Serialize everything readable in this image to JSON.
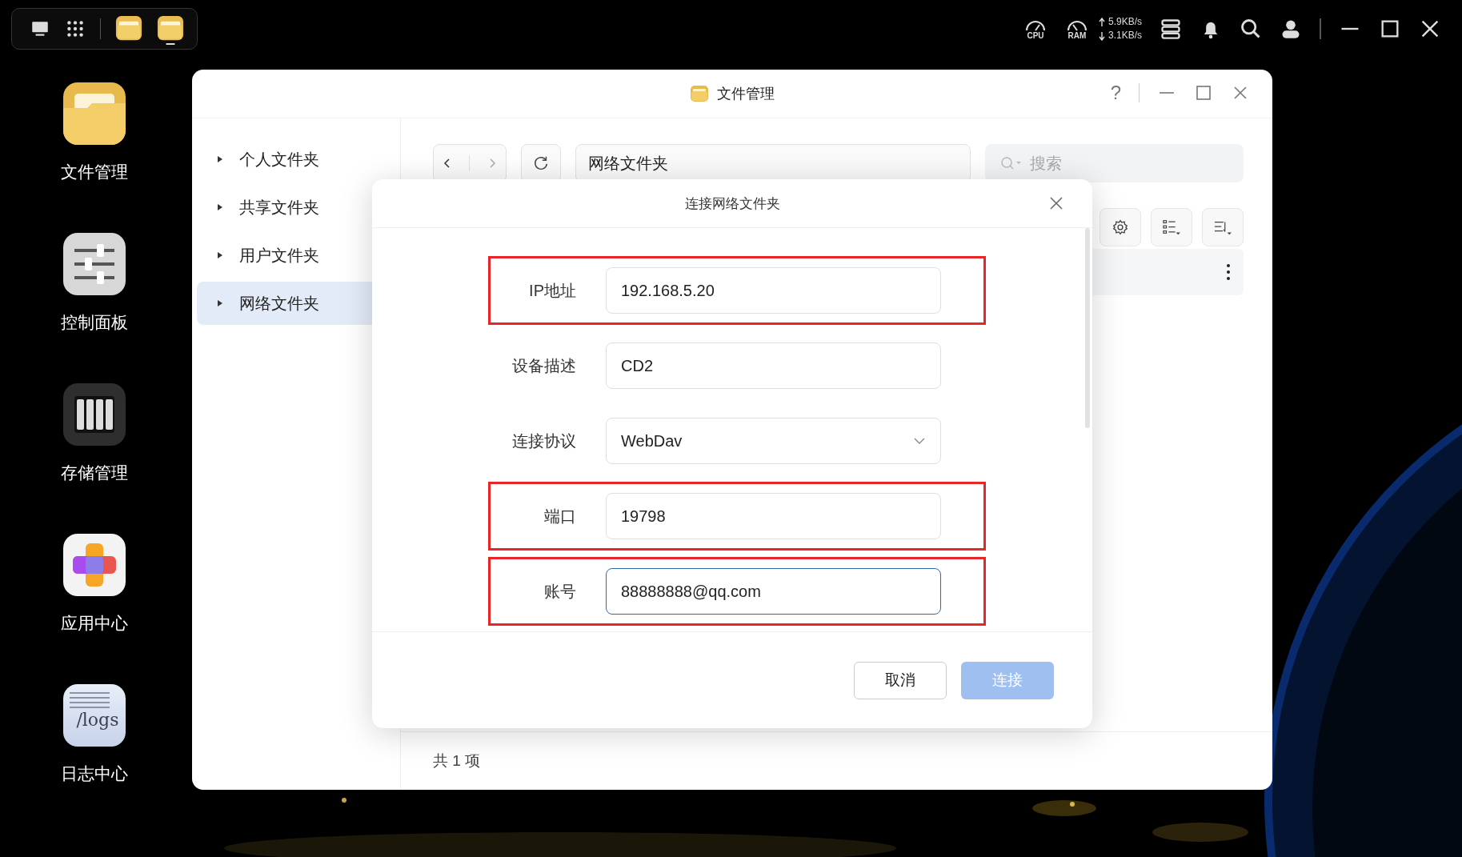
{
  "topbar": {
    "cpu_label": "CPU",
    "ram_label": "RAM",
    "upload": "5.9KB/s",
    "download": "3.1KB/s",
    "open_apps": [
      {
        "kind": "files",
        "running": false
      },
      {
        "kind": "files",
        "running": true
      }
    ]
  },
  "desktop_icons": [
    {
      "label": "文件管理",
      "kind": "files"
    },
    {
      "label": "控制面板",
      "kind": "control"
    },
    {
      "label": "存储管理",
      "kind": "storage"
    },
    {
      "label": "应用中心",
      "kind": "apps"
    },
    {
      "label": "日志中心",
      "kind": "logs",
      "icon_text": "/logs"
    }
  ],
  "window": {
    "title": "文件管理",
    "help": "?",
    "sidebar": [
      {
        "label": "个人文件夹",
        "selected": false
      },
      {
        "label": "共享文件夹",
        "selected": false
      },
      {
        "label": "用户文件夹",
        "selected": false
      },
      {
        "label": "网络文件夹",
        "selected": true
      }
    ],
    "path": "网络文件夹",
    "search": {
      "placeholder": "搜索"
    },
    "footer": "共 1 项"
  },
  "dialog": {
    "title": "连接网络文件夹",
    "fields": [
      {
        "label": "IP地址",
        "value": "192.168.5.20",
        "kind": "text",
        "highlighted": true,
        "focused": false
      },
      {
        "label": "设备描述",
        "value": "CD2",
        "kind": "text",
        "highlighted": false,
        "focused": false
      },
      {
        "label": "连接协议",
        "value": "WebDav",
        "kind": "select",
        "highlighted": false,
        "focused": false
      },
      {
        "label": "端口",
        "value": "19798",
        "kind": "text",
        "highlighted": true,
        "focused": false
      },
      {
        "label": "账号",
        "value": "88888888@qq.com",
        "kind": "text",
        "highlighted": true,
        "focused": true
      }
    ],
    "buttons": [
      {
        "label": "取消",
        "kind": "secondary",
        "disabled": false
      },
      {
        "label": "连接",
        "kind": "primary",
        "disabled": true
      }
    ]
  }
}
